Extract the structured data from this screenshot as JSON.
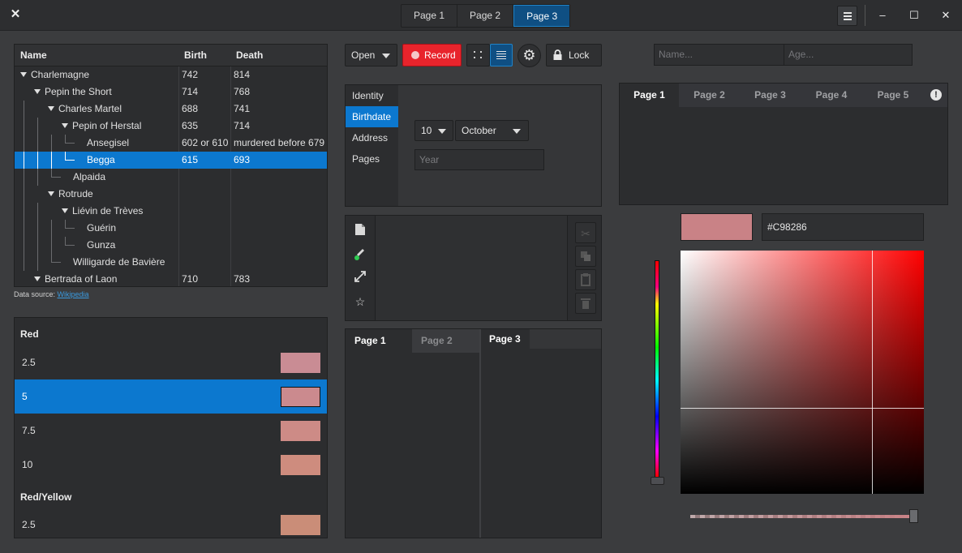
{
  "window": {
    "tabs": [
      "Page 1",
      "Page 2",
      "Page 3"
    ],
    "active_tab": 2,
    "close_glyph": "✕",
    "minimize_glyph": "–",
    "maximize_glyph": "☐",
    "window_close_glyph": "✕"
  },
  "tree": {
    "headers": [
      "Name",
      "Birth",
      "Death"
    ],
    "rows": [
      {
        "name": "Charlemagne",
        "birth": "742",
        "death": "814",
        "depth": 0,
        "expanded": true
      },
      {
        "name": "Pepin the Short",
        "birth": "714",
        "death": "768",
        "depth": 1,
        "expanded": true
      },
      {
        "name": "Charles Martel",
        "birth": "688",
        "death": "741",
        "depth": 2,
        "expanded": true
      },
      {
        "name": "Pepin of Herstal",
        "birth": "635",
        "death": "714",
        "depth": 3,
        "expanded": true
      },
      {
        "name": "Ansegisel",
        "birth": "602 or 610",
        "death": "murdered before 679",
        "depth": 4
      },
      {
        "name": "Begga",
        "birth": "615",
        "death": "693",
        "depth": 4,
        "selected": true
      },
      {
        "name": "Alpaida",
        "birth": "",
        "death": "",
        "depth": 3
      },
      {
        "name": "Rotrude",
        "birth": "",
        "death": "",
        "depth": 2,
        "expanded": true
      },
      {
        "name": "Liévin de Trèves",
        "birth": "",
        "death": "",
        "depth": 3,
        "expanded": true
      },
      {
        "name": "Guérin",
        "birth": "",
        "death": "",
        "depth": 4
      },
      {
        "name": "Gunza",
        "birth": "",
        "death": "",
        "depth": 4
      },
      {
        "name": "Willigarde de Bavière",
        "birth": "",
        "death": "",
        "depth": 3
      },
      {
        "name": "Bertrada of Laon",
        "birth": "710",
        "death": "783",
        "depth": 1,
        "expanded": true
      }
    ],
    "source_label": "Data source:",
    "source_link": "Wikipedia"
  },
  "color_list": {
    "groups": [
      {
        "label": "Red",
        "items": [
          {
            "value": "2.5",
            "color": "#c98c94"
          },
          {
            "value": "5",
            "color": "#cb8a8e",
            "selected": true
          },
          {
            "value": "7.5",
            "color": "#cd8b86"
          },
          {
            "value": "10",
            "color": "#ce8c7e"
          }
        ]
      },
      {
        "label": "Red/Yellow",
        "items": [
          {
            "value": "2.5",
            "color": "#ca8d78"
          }
        ]
      }
    ]
  },
  "toolbar": {
    "open_label": "Open",
    "record_label": "Record",
    "lock_label": "Lock",
    "record_color": "#e8242c"
  },
  "form": {
    "tabs": [
      "Identity",
      "Birthdate",
      "Address",
      "Pages"
    ],
    "active_tab": 1,
    "day": "10",
    "month": "October",
    "year_placeholder": "Year"
  },
  "icon_toolbar": {
    "left_icons": [
      "file-icon",
      "eyedropper-icon",
      "expand-icon",
      "star-icon"
    ],
    "right_icons": [
      "cut-icon",
      "copy-icon",
      "paste-icon",
      "trash-icon"
    ]
  },
  "split_tabs": {
    "left": [
      "Page 1",
      "Page 2"
    ],
    "right": [
      "Page 3"
    ]
  },
  "inputs": {
    "name_placeholder": "Name...",
    "age_placeholder": "Age..."
  },
  "tab_panel": {
    "tabs": [
      "Page 1",
      "Page 2",
      "Page 3",
      "Page 4",
      "Page 5"
    ],
    "active_tab": 0,
    "alert_glyph": "!"
  },
  "color_picker": {
    "hex": "#C98286",
    "color": "#c98286"
  }
}
